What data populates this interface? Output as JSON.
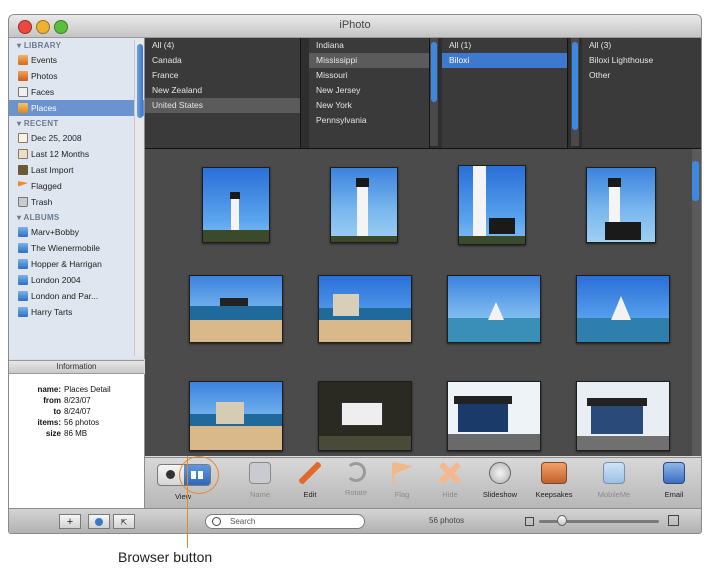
{
  "window": {
    "title": "iPhoto"
  },
  "sidebar": {
    "library_label": "LIBRARY",
    "library": [
      {
        "label": "Events",
        "icon": "events-icon"
      },
      {
        "label": "Photos",
        "icon": "photos-icon"
      },
      {
        "label": "Faces",
        "icon": "faces-icon"
      },
      {
        "label": "Places",
        "icon": "places-icon",
        "selected": true
      }
    ],
    "recent_label": "RECENT",
    "recent": [
      {
        "label": "Dec 25, 2008",
        "icon": "calendar-icon"
      },
      {
        "label": "Last 12 Months",
        "icon": "clock-icon"
      },
      {
        "label": "Last Import",
        "icon": "import-icon"
      },
      {
        "label": "Flagged",
        "icon": "flag-icon"
      },
      {
        "label": "Trash",
        "icon": "trash-icon"
      }
    ],
    "albums_label": "ALBUMS",
    "albums": [
      {
        "label": "Marv+Bobby"
      },
      {
        "label": "The Wienermobile"
      },
      {
        "label": "Hopper & Harrigan"
      },
      {
        "label": "London 2004"
      },
      {
        "label": "London and Par..."
      },
      {
        "label": "Harry Tarts"
      }
    ]
  },
  "information": {
    "header": "Information",
    "rows": [
      {
        "key": "name:",
        "value": "Places Detail"
      },
      {
        "key": "from",
        "value": "8/23/07"
      },
      {
        "key": "to",
        "value": "8/24/07"
      },
      {
        "key": "items:",
        "value": "56 photos"
      },
      {
        "key": "size",
        "value": "86 MB"
      }
    ]
  },
  "browser": {
    "countries": [
      "All (4)",
      "Canada",
      "France",
      "New Zealand",
      "United States"
    ],
    "states": [
      "Indiana",
      "Mississippi",
      "Missouri",
      "New Jersey",
      "New York",
      "Pennsylvania"
    ],
    "cities": [
      "All (1)",
      "Biloxi"
    ],
    "places": [
      "All (3)",
      "Biloxi Lighthouse",
      "Other"
    ]
  },
  "toolbar": {
    "view": "View",
    "tools": [
      {
        "label": "Name",
        "icon": "name-icon",
        "dim": true
      },
      {
        "label": "Edit",
        "icon": "edit-icon",
        "dim": false
      },
      {
        "label": "Rotate",
        "icon": "rotate-icon",
        "dim": true
      },
      {
        "label": "Flag",
        "icon": "flag-icon",
        "dim": true
      },
      {
        "label": "Hide",
        "icon": "hide-icon",
        "dim": true
      },
      {
        "label": "Slideshow",
        "icon": "slideshow-icon",
        "dim": false
      },
      {
        "label": "Keepsakes",
        "icon": "keepsakes-icon",
        "dim": false
      },
      {
        "label": "MobileMe",
        "icon": "mobileme-icon",
        "dim": true
      },
      {
        "label": "Email",
        "icon": "email-icon",
        "dim": false
      }
    ]
  },
  "bottombar": {
    "add": "+",
    "search_placeholder": "Search",
    "photo_count": "56 photos"
  },
  "caption": "Browser button",
  "colors": {
    "accent": "#3f78cf",
    "callout": "#e08a2a",
    "grid_bg": "#4b4b4b"
  }
}
